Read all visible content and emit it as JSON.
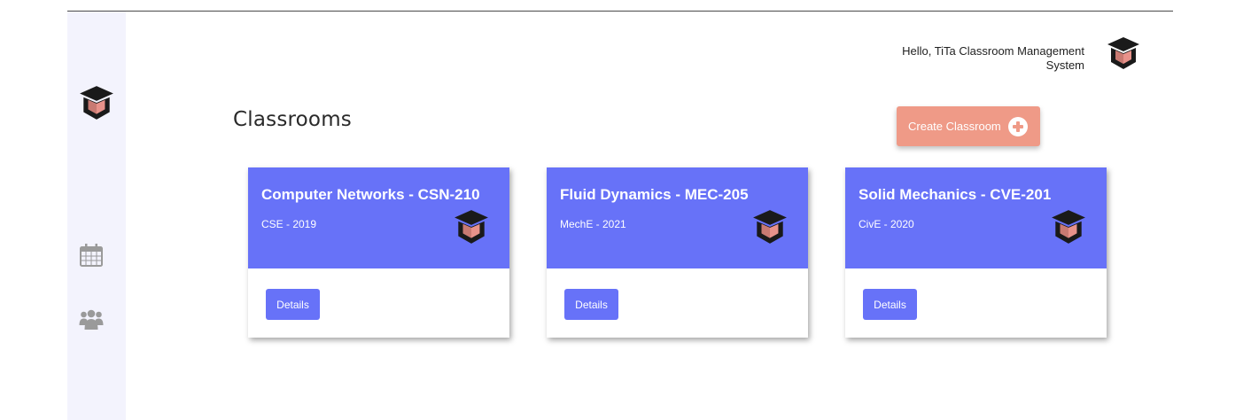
{
  "header": {
    "greeting": "Hello, TiTa Classroom Management System",
    "logo_icon": "graduation-cap-icon"
  },
  "sidebar": {
    "logo_icon": "graduation-cap-icon",
    "items": [
      {
        "name": "calendar",
        "icon": "calendar-icon"
      },
      {
        "name": "users",
        "icon": "users-icon"
      }
    ]
  },
  "main": {
    "title": "Classrooms",
    "create_button": {
      "label": "Create Classroom",
      "icon": "plus-circle-icon"
    },
    "cards": [
      {
        "title": "Computer Networks - CSN-210",
        "subtitle": "CSE - 2019",
        "button": "Details"
      },
      {
        "title": "Fluid Dynamics - MEC-205",
        "subtitle": "MechE - 2021",
        "button": "Details"
      },
      {
        "title": "Solid Mechanics - CVE-201",
        "subtitle": "CivE - 2020",
        "button": "Details"
      }
    ]
  },
  "colors": {
    "primary": "#6772f8",
    "accent": "#ef9a87",
    "sidebar_bg": "#f3f3fd",
    "logo_dark": "#1a1a1a",
    "logo_pink": "#e8928a"
  }
}
